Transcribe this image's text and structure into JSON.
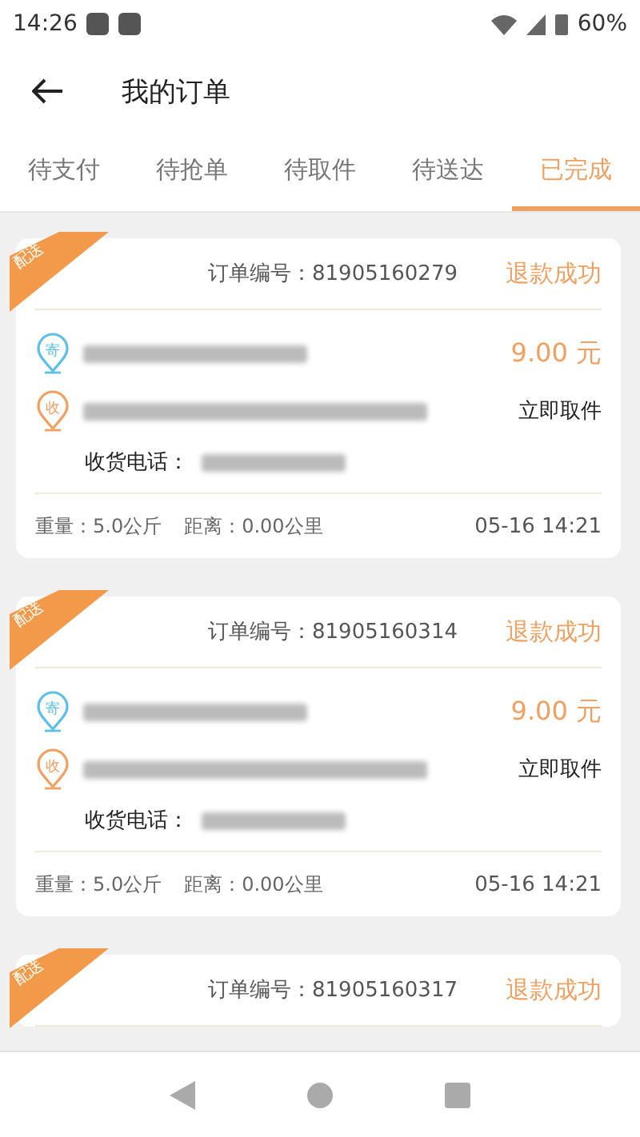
{
  "status_bar": {
    "time": "14:26",
    "battery": "60%"
  },
  "header": {
    "title": "我的订单"
  },
  "tabs": [
    {
      "label": "待支付",
      "selected": false
    },
    {
      "label": "待抢单",
      "selected": false
    },
    {
      "label": "待取件",
      "selected": false
    },
    {
      "label": "待送达",
      "selected": false
    },
    {
      "label": "已完成",
      "selected": true
    }
  ],
  "orders": [
    {
      "tag": "配送",
      "order_no": "订单编号：81905160279",
      "status": "退款成功",
      "sender_icon": "寄",
      "receiver_icon": "收",
      "price": "9.00 元",
      "action": "立即取件",
      "phone_label": "收货电话：",
      "weight": "重量：5.0公斤",
      "distance": "距离：0.00公里",
      "time": "05-16 14:21"
    },
    {
      "tag": "配送",
      "order_no": "订单编号：81905160314",
      "status": "退款成功",
      "sender_icon": "寄",
      "receiver_icon": "收",
      "price": "9.00 元",
      "action": "立即取件",
      "phone_label": "收货电话：",
      "weight": "重量：5.0公斤",
      "distance": "距离：0.00公里",
      "time": "05-16 14:21"
    },
    {
      "tag": "配送",
      "order_no": "订单编号：81905160317",
      "status": "退款成功"
    }
  ]
}
